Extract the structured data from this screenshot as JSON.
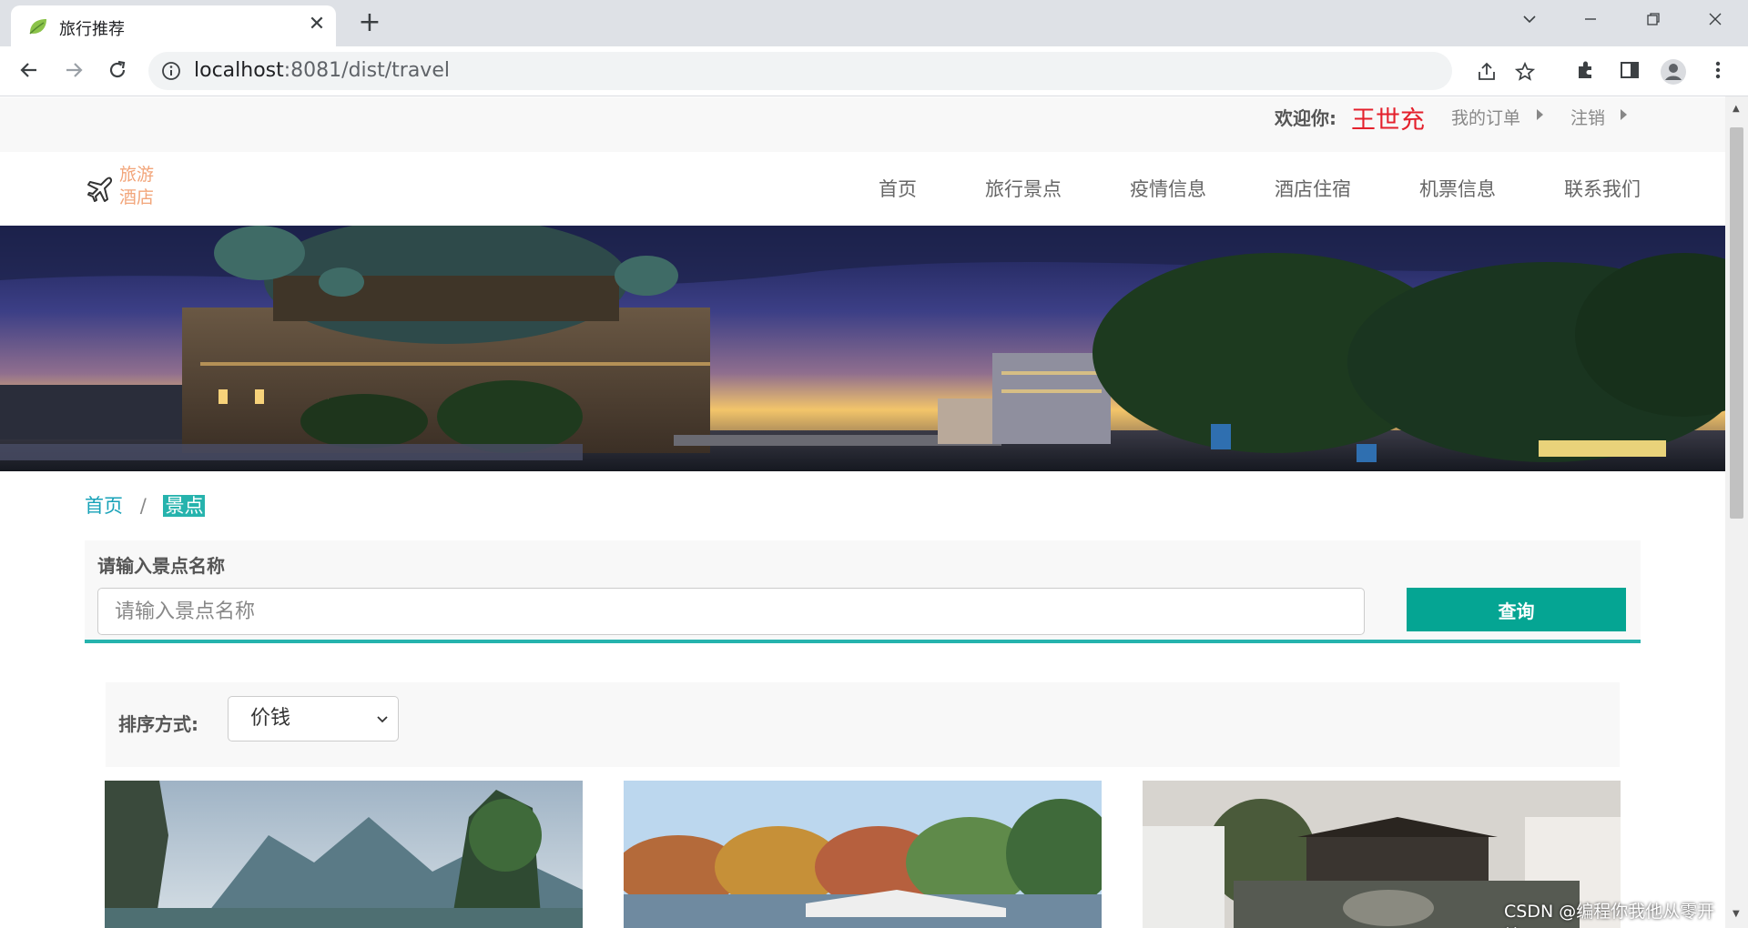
{
  "browser": {
    "tab_title": "旅行推荐",
    "url_host": "localhost",
    "url_rest": ":8081/dist/travel"
  },
  "userbar": {
    "welcome_label": "欢迎你:",
    "username": "王世充",
    "my_orders": "我的订单",
    "logout": "注销"
  },
  "navbar": {
    "logo_line1": "旅游",
    "logo_line2": "酒店",
    "items": [
      {
        "label": "首页"
      },
      {
        "label": "旅行景点"
      },
      {
        "label": "疫情信息"
      },
      {
        "label": "酒店住宿"
      },
      {
        "label": "机票信息"
      },
      {
        "label": "联系我们"
      }
    ]
  },
  "breadcrumb": {
    "home": "首页",
    "separator": "/",
    "current": "景点"
  },
  "search": {
    "label": "请输入景点名称",
    "placeholder": "请输入景点名称",
    "value": "",
    "button": "查询"
  },
  "sort": {
    "label": "排序方式:",
    "selected": "价钱"
  },
  "watermark": "CSDN @编程你我他从零开始",
  "colors": {
    "accent": "#26b3ad",
    "button": "#05a593",
    "username": "#e4202c",
    "logo": "#f2a57a"
  }
}
